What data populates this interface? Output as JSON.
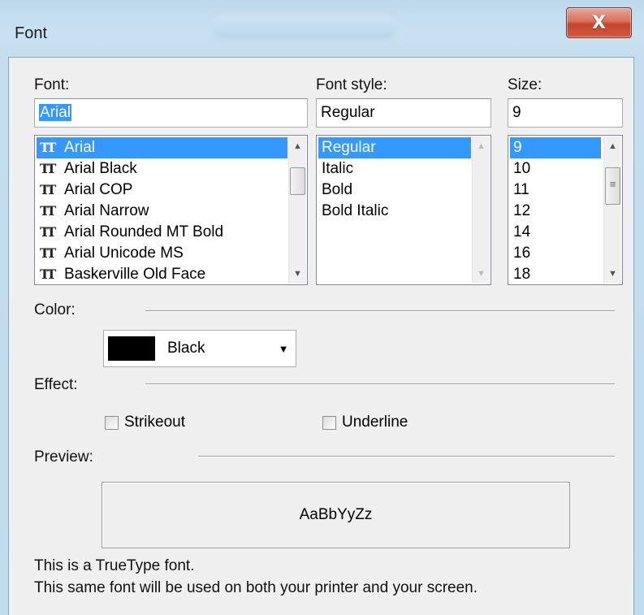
{
  "window": {
    "title": "Font",
    "close_glyph": "X"
  },
  "font": {
    "label": "Font:",
    "value": "Arial",
    "items": [
      {
        "icon": "truetype-icon",
        "label": "Arial"
      },
      {
        "icon": "truetype-icon",
        "label": "Arial Black"
      },
      {
        "icon": "truetype-icon",
        "label": "Arial COP"
      },
      {
        "icon": "truetype-icon",
        "label": "Arial Narrow"
      },
      {
        "icon": "truetype-icon",
        "label": "Arial Rounded MT Bold"
      },
      {
        "icon": "truetype-icon",
        "label": "Arial Unicode MS"
      },
      {
        "icon": "truetype-icon",
        "label": "Baskerville Old Face"
      }
    ],
    "selected_index": 0
  },
  "style": {
    "label": "Font style:",
    "value": "Regular",
    "items": [
      "Regular",
      "Italic",
      "Bold",
      "Bold Italic"
    ],
    "selected_index": 0
  },
  "size": {
    "label": "Size:",
    "value": "9",
    "items": [
      "9",
      "10",
      "11",
      "12",
      "14",
      "16",
      "18"
    ],
    "selected_index": 0
  },
  "color": {
    "label": "Color:",
    "value": "Black",
    "swatch": "#000000"
  },
  "effect": {
    "label": "Effect:",
    "strikeout": {
      "label": "Strikeout",
      "checked": false
    },
    "underline": {
      "label": "Underline",
      "checked": false
    }
  },
  "preview": {
    "label": "Preview:",
    "sample": "AaBbYyZz"
  },
  "info": {
    "line1": "This is a TrueType font.",
    "line2": "This same font will be used on both your printer and your screen."
  },
  "colors": {
    "selection": "#3399ff",
    "close_button": "#c4452c"
  }
}
